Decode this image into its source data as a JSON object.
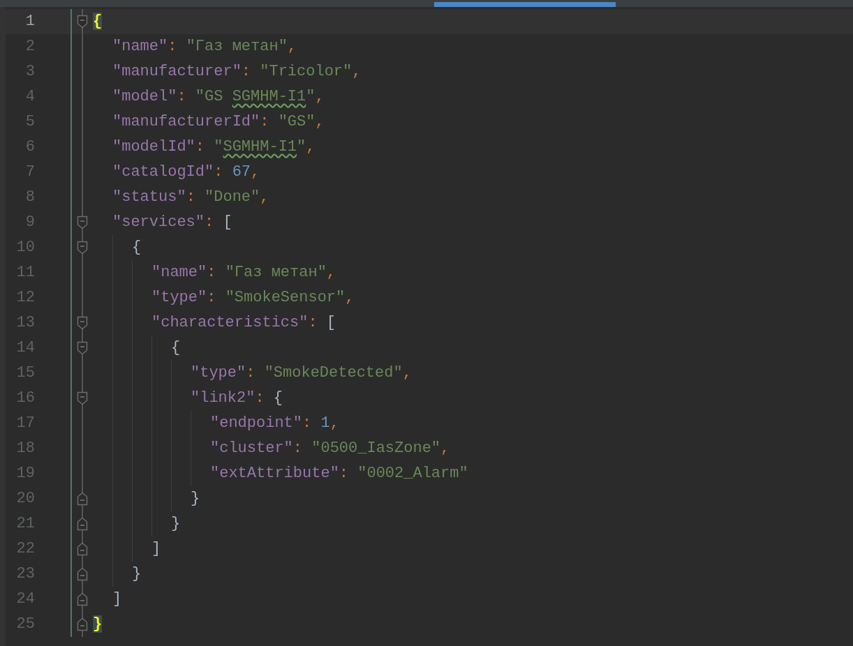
{
  "editor": {
    "lines": [
      {
        "number": "1",
        "current": true,
        "closes_block": false,
        "tokens": [
          {
            "kind": "matched_bracket",
            "text": "{"
          }
        ],
        "children": [
          {
            "number": "2",
            "current": false,
            "closes_block": false,
            "tokens": [
              {
                "kind": "key",
                "text": "\"name\""
              },
              {
                "kind": "punct",
                "text": ": "
              },
              {
                "kind": "string",
                "text": "\"Газ метан\""
              },
              {
                "kind": "punct",
                "text": ","
              }
            ]
          },
          {
            "number": "3",
            "current": false,
            "closes_block": false,
            "tokens": [
              {
                "kind": "key",
                "text": "\"manufacturer\""
              },
              {
                "kind": "punct",
                "text": ": "
              },
              {
                "kind": "string",
                "text": "\"Tricolor\""
              },
              {
                "kind": "punct",
                "text": ","
              }
            ]
          },
          {
            "number": "4",
            "current": false,
            "closes_block": false,
            "tokens": [
              {
                "kind": "key",
                "text": "\"model\""
              },
              {
                "kind": "punct",
                "text": ": "
              },
              {
                "kind": "string",
                "text": "\"GS "
              },
              {
                "kind": "typo_string",
                "text": "SGMHM-I1"
              },
              {
                "kind": "string",
                "text": "\""
              },
              {
                "kind": "punct",
                "text": ","
              }
            ]
          },
          {
            "number": "5",
            "current": false,
            "closes_block": false,
            "tokens": [
              {
                "kind": "key",
                "text": "\"manufacturerId\""
              },
              {
                "kind": "punct",
                "text": ": "
              },
              {
                "kind": "string",
                "text": "\"GS\""
              },
              {
                "kind": "punct",
                "text": ","
              }
            ]
          },
          {
            "number": "6",
            "current": false,
            "closes_block": false,
            "tokens": [
              {
                "kind": "key",
                "text": "\"modelId\""
              },
              {
                "kind": "punct",
                "text": ": "
              },
              {
                "kind": "string",
                "text": "\""
              },
              {
                "kind": "typo_string",
                "text": "SGMHM-I1"
              },
              {
                "kind": "string",
                "text": "\""
              },
              {
                "kind": "punct",
                "text": ","
              }
            ]
          },
          {
            "number": "7",
            "current": false,
            "closes_block": false,
            "tokens": [
              {
                "kind": "key",
                "text": "\"catalogId\""
              },
              {
                "kind": "punct",
                "text": ": "
              },
              {
                "kind": "number",
                "text": "67"
              },
              {
                "kind": "punct",
                "text": ","
              }
            ]
          },
          {
            "number": "8",
            "current": false,
            "closes_block": false,
            "tokens": [
              {
                "kind": "key",
                "text": "\"status\""
              },
              {
                "kind": "punct",
                "text": ": "
              },
              {
                "kind": "string",
                "text": "\"Done\""
              },
              {
                "kind": "punct",
                "text": ","
              }
            ]
          },
          {
            "number": "9",
            "current": false,
            "closes_block": false,
            "tokens": [
              {
                "kind": "key",
                "text": "\"services\""
              },
              {
                "kind": "punct",
                "text": ": "
              },
              {
                "kind": "bracket",
                "text": "["
              }
            ],
            "children": [
              {
                "number": "10",
                "current": false,
                "closes_block": false,
                "tokens": [
                  {
                    "kind": "bracket",
                    "text": "{"
                  }
                ],
                "children": [
                  {
                    "number": "11",
                    "current": false,
                    "closes_block": false,
                    "tokens": [
                      {
                        "kind": "key",
                        "text": "\"name\""
                      },
                      {
                        "kind": "punct",
                        "text": ": "
                      },
                      {
                        "kind": "string",
                        "text": "\"Газ метан\""
                      },
                      {
                        "kind": "punct",
                        "text": ","
                      }
                    ]
                  },
                  {
                    "number": "12",
                    "current": false,
                    "closes_block": false,
                    "tokens": [
                      {
                        "kind": "key",
                        "text": "\"type\""
                      },
                      {
                        "kind": "punct",
                        "text": ": "
                      },
                      {
                        "kind": "string",
                        "text": "\"SmokeSensor\""
                      },
                      {
                        "kind": "punct",
                        "text": ","
                      }
                    ]
                  },
                  {
                    "number": "13",
                    "current": false,
                    "closes_block": false,
                    "tokens": [
                      {
                        "kind": "key",
                        "text": "\"characteristics\""
                      },
                      {
                        "kind": "punct",
                        "text": ": "
                      },
                      {
                        "kind": "bracket",
                        "text": "["
                      }
                    ],
                    "children": [
                      {
                        "number": "14",
                        "current": false,
                        "closes_block": false,
                        "tokens": [
                          {
                            "kind": "bracket",
                            "text": "{"
                          }
                        ],
                        "children": [
                          {
                            "number": "15",
                            "current": false,
                            "closes_block": false,
                            "tokens": [
                              {
                                "kind": "key",
                                "text": "\"type\""
                              },
                              {
                                "kind": "punct",
                                "text": ": "
                              },
                              {
                                "kind": "string",
                                "text": "\"SmokeDetected\""
                              },
                              {
                                "kind": "punct",
                                "text": ","
                              }
                            ]
                          },
                          {
                            "number": "16",
                            "current": false,
                            "closes_block": false,
                            "tokens": [
                              {
                                "kind": "key",
                                "text": "\"link2\""
                              },
                              {
                                "kind": "punct",
                                "text": ": "
                              },
                              {
                                "kind": "bracket",
                                "text": "{"
                              }
                            ],
                            "children": [
                              {
                                "number": "17",
                                "current": false,
                                "closes_block": false,
                                "tokens": [
                                  {
                                    "kind": "key",
                                    "text": "\"endpoint\""
                                  },
                                  {
                                    "kind": "punct",
                                    "text": ": "
                                  },
                                  {
                                    "kind": "number",
                                    "text": "1"
                                  },
                                  {
                                    "kind": "punct",
                                    "text": ","
                                  }
                                ]
                              },
                              {
                                "number": "18",
                                "current": false,
                                "closes_block": false,
                                "tokens": [
                                  {
                                    "kind": "key",
                                    "text": "\"cluster\""
                                  },
                                  {
                                    "kind": "punct",
                                    "text": ": "
                                  },
                                  {
                                    "kind": "string",
                                    "text": "\"0500_IasZone\""
                                  },
                                  {
                                    "kind": "punct",
                                    "text": ","
                                  }
                                ]
                              },
                              {
                                "number": "19",
                                "current": false,
                                "closes_block": false,
                                "tokens": [
                                  {
                                    "kind": "key",
                                    "text": "\"extAttribute\""
                                  },
                                  {
                                    "kind": "punct",
                                    "text": ": "
                                  },
                                  {
                                    "kind": "string",
                                    "text": "\"0002_Alarm\""
                                  }
                                ]
                              }
                            ]
                          },
                          {
                            "number": "20",
                            "current": false,
                            "closes_block": true,
                            "tokens": [
                              {
                                "kind": "bracket",
                                "text": "}"
                              }
                            ]
                          }
                        ]
                      },
                      {
                        "number": "21",
                        "current": false,
                        "closes_block": true,
                        "tokens": [
                          {
                            "kind": "bracket",
                            "text": "}"
                          }
                        ]
                      }
                    ]
                  },
                  {
                    "number": "22",
                    "current": false,
                    "closes_block": true,
                    "tokens": [
                      {
                        "kind": "bracket",
                        "text": "]"
                      }
                    ]
                  }
                ]
              },
              {
                "number": "23",
                "current": false,
                "closes_block": true,
                "tokens": [
                  {
                    "kind": "bracket",
                    "text": "}"
                  }
                ]
              }
            ]
          },
          {
            "number": "24",
            "current": false,
            "closes_block": true,
            "tokens": [
              {
                "kind": "bracket",
                "text": "]"
              }
            ]
          }
        ]
      },
      {
        "number": "25",
        "current": false,
        "closes_block": true,
        "tokens": [
          {
            "kind": "matched_bracket",
            "text": "}"
          }
        ]
      }
    ]
  }
}
